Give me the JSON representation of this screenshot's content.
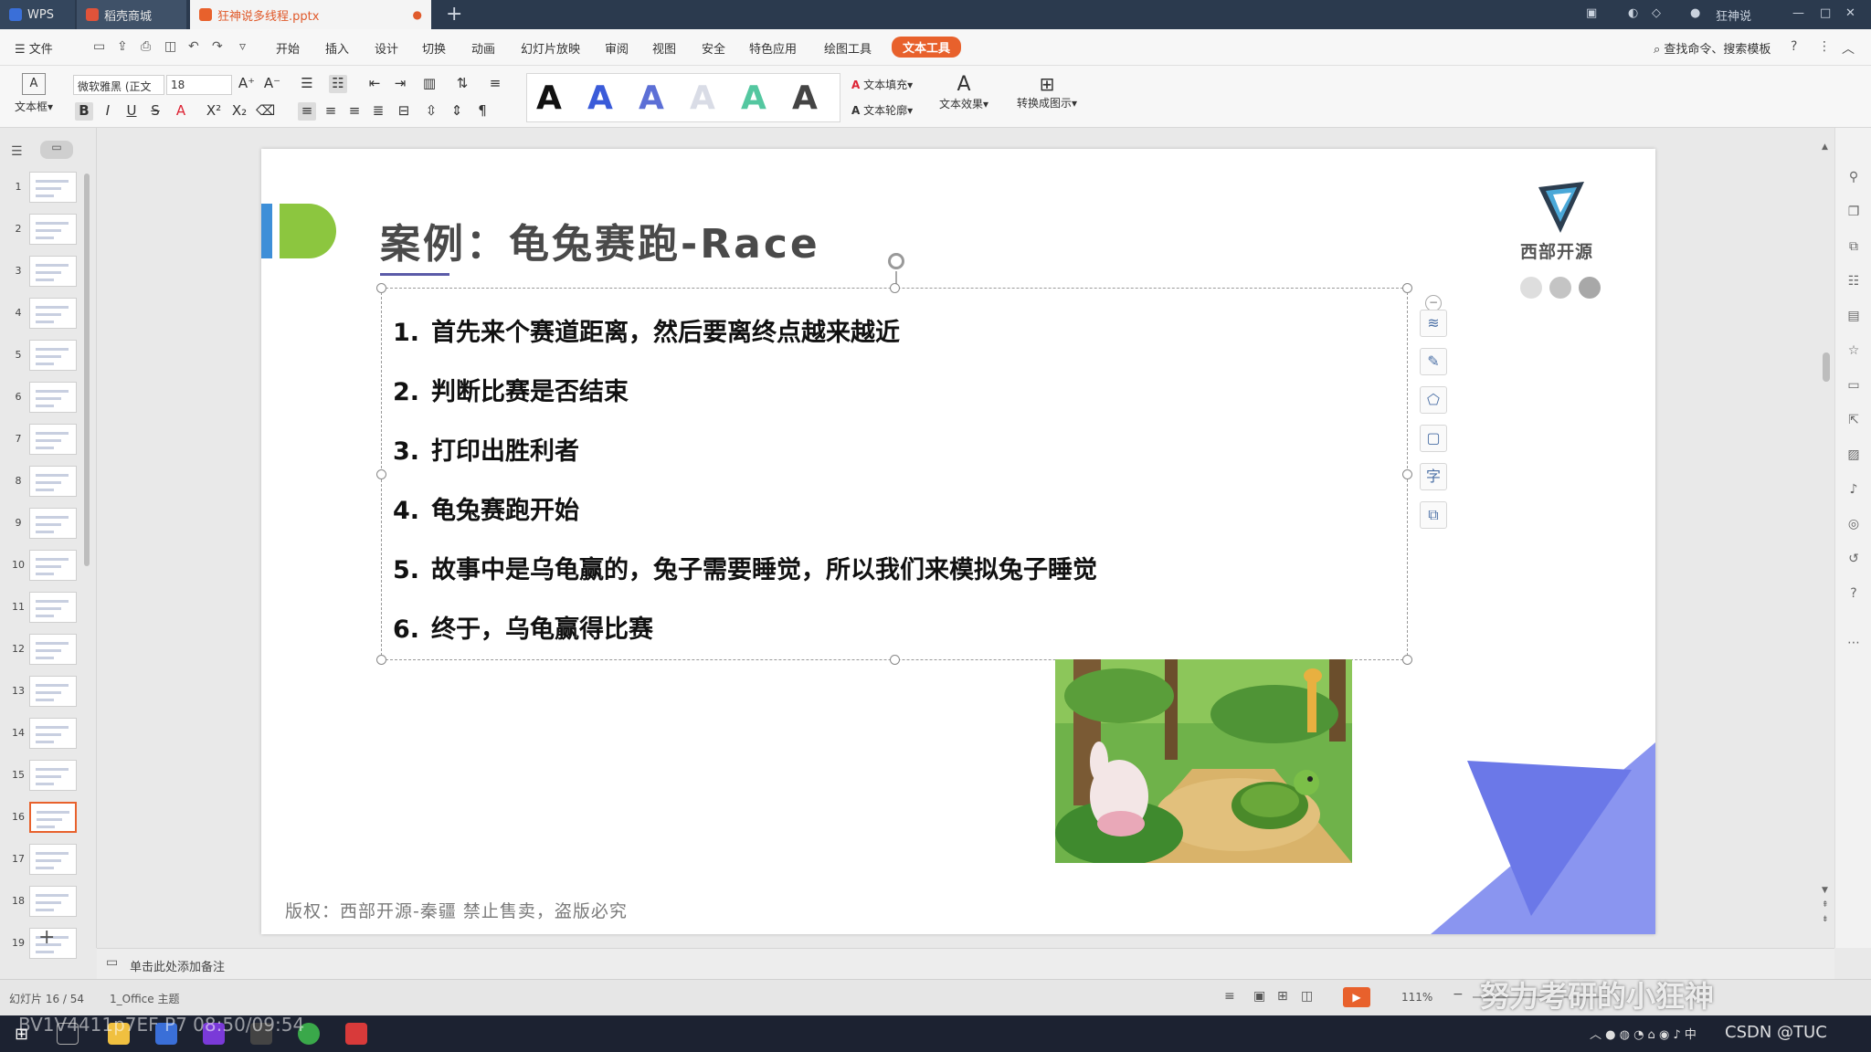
{
  "window": {
    "tabs": [
      {
        "label": "WPS"
      },
      {
        "label": "稻壳商城"
      },
      {
        "label": "狂神说多线程.pptx"
      }
    ],
    "new_tab_symbol": "+",
    "user": "狂神说"
  },
  "menu": {
    "file": "文件",
    "items": [
      "开始",
      "插入",
      "设计",
      "切换",
      "动画",
      "幻灯片放映",
      "审阅",
      "视图",
      "安全",
      "特色应用",
      "绘图工具",
      "文本工具"
    ],
    "active": "文本工具",
    "search": "查找命令、搜索模板"
  },
  "ribbon": {
    "textbox_label": "文本框",
    "font_name": "微软雅黑 (正文",
    "font_size": "18",
    "text_fill": "文本填充",
    "text_outline": "文本轮廓",
    "text_effect": "文本效果",
    "convert": "转换成图示",
    "style_letter": "A",
    "style_colors": [
      "#111111",
      "#3a5bd9",
      "#5c6fd6",
      "#d9dce6",
      "#54c7a0",
      "#444444"
    ]
  },
  "slides_panel": {
    "numbers": [
      "1",
      "2",
      "3",
      "4",
      "5",
      "6",
      "7",
      "8",
      "9",
      "10",
      "11",
      "12",
      "13",
      "14",
      "15",
      "16",
      "17",
      "18",
      "19"
    ],
    "selected": "16",
    "add_symbol": "+"
  },
  "slide": {
    "title": "案例：龟兔赛跑-Race",
    "items": [
      {
        "num": "1.",
        "text": "首先来个赛道距离，然后要离终点越来越近"
      },
      {
        "num": "2.",
        "text": "判断比赛是否结束"
      },
      {
        "num": "3.",
        "text": "打印出胜利者"
      },
      {
        "num": "4.",
        "text": "龟兔赛跑开始"
      },
      {
        "num": "5.",
        "text": "故事中是乌龟赢的，兔子需要睡觉，所以我们来模拟兔子睡觉"
      },
      {
        "num": "6.",
        "text": "终于，乌龟赢得比赛"
      }
    ],
    "footer": "版权：西部开源-秦疆    禁止售卖，盗版必究",
    "logo_text": "西部开源",
    "accent_colors": {
      "blue": "#3e8fd8",
      "green": "#8cc63f",
      "triangle": "#6b78e8"
    }
  },
  "notes": {
    "placeholder": "单击此处添加备注"
  },
  "status": {
    "slide_counter": "幻灯片 16 / 54",
    "theme": "1_Office 主题",
    "zoom": "111%"
  },
  "overlay": {
    "video_info": "BV1V4411p7EF P7 08:50/09:54",
    "watermark": "努力考研的小狂神",
    "csdn": "CSDN @TUC"
  }
}
